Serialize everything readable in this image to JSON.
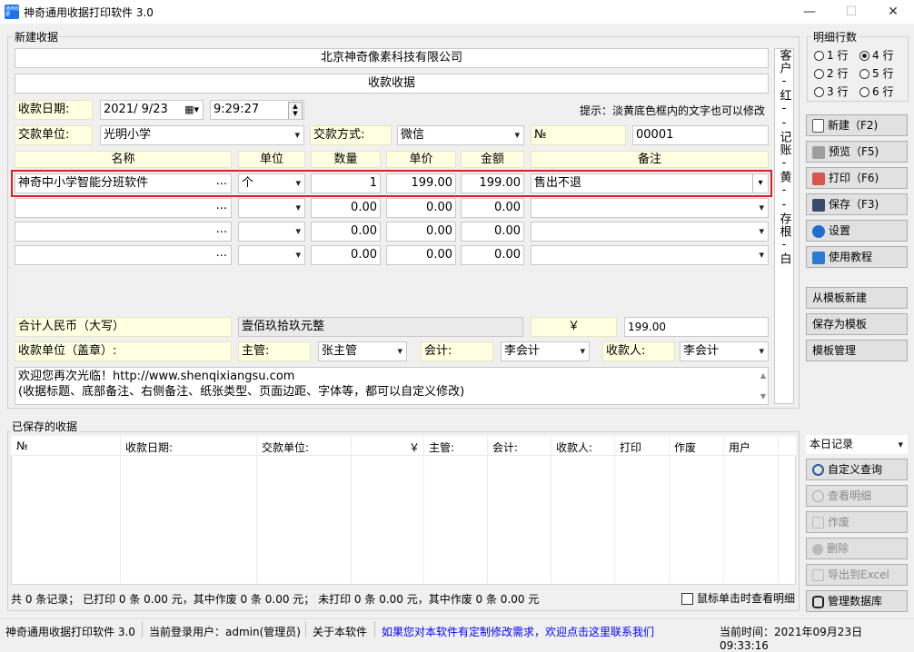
{
  "window": {
    "title": "神奇通用收据打印软件 3.0",
    "icon_text": "通用收据",
    "min": "—",
    "max": "☐",
    "close": "✕"
  },
  "receipt": {
    "group_label": "新建收据",
    "company": "北京神奇像素科技有限公司",
    "doc_title": "收款收据",
    "date_label": "收款日期:",
    "date_value": "2021/  9/23",
    "time_value": "9:29:27",
    "hint": "提示：淡黄底色框内的文字也可以修改",
    "payer_label": "交款单位:",
    "payer_value": "光明小学",
    "method_label": "交款方式:",
    "method_value": "微信",
    "no_label": "№",
    "no_value": "00001",
    "columns": [
      "名称",
      "单位",
      "数量",
      "单价",
      "金额",
      "备注"
    ],
    "rows": [
      {
        "name": "神奇中小学智能分班软件",
        "unit": "个",
        "qty": "1",
        "price": "199.00",
        "amount": "199.00",
        "note": "售出不退"
      },
      {
        "name": "",
        "unit": "",
        "qty": "",
        "price": "0.00",
        "amount": "0.00",
        "note": ""
      },
      {
        "name": "",
        "unit": "",
        "qty": "",
        "price": "0.00",
        "amount": "0.00",
        "note": ""
      },
      {
        "name": "",
        "unit": "",
        "qty": "",
        "price": "0.00",
        "amount": "0.00",
        "note": ""
      }
    ],
    "row_dots": "...",
    "total_label": "合计人民币（大写）",
    "total_words": "壹佰玖拾玖元整",
    "yen": "￥",
    "total_value": "199.00",
    "seal_label": "收款单位（盖章）:",
    "manager_label": "主管:",
    "manager_value": "张主管",
    "accountant_label": "会计:",
    "accountant_value": "李会计",
    "cashier_label": "收款人:",
    "cashier_value": "李会计",
    "footer_line1": "欢迎您再次光临！http://www.shenqixiangsu.com",
    "footer_line2": "(收据标题、底部备注、右侧备注、纸张类型、页面边距、字体等，都可以自定义修改)",
    "side_note": "客户-红--记账-黄--存根-白"
  },
  "rows_setting": {
    "label": "明细行数",
    "options": [
      "1 行",
      "2 行",
      "3 行",
      "4 行",
      "5 行",
      "6 行"
    ],
    "selected": "4 行"
  },
  "actions": {
    "new": "新建（F2)",
    "preview": "预览（F5)",
    "print": "打印（F6)",
    "save": "保存（F3)",
    "settings": "设置",
    "tutorial": "使用教程",
    "from_template": "从模板新建",
    "save_template": "保存为模板",
    "manage_template": "模板管理"
  },
  "saved": {
    "group_label": "已保存的收据",
    "columns": [
      "№",
      "收款日期:",
      "交款单位:",
      "￥",
      "主管:",
      "会计:",
      "收款人:",
      "打印",
      "作废",
      "用户"
    ],
    "filter_value": "本日记录",
    "query": "自定义查询",
    "view_detail": "查看明细",
    "void": "作废",
    "delete": "删除",
    "export": "导出到Excel",
    "manage_db": "管理数据库",
    "summary": "共 0 条记录；  已打印 0 条 0.00 元，其中作废 0 条 0.00 元；  未打印 0 条 0.00 元，其中作废 0 条 0.00 元",
    "click_detail": "鼠标单击时查看明细"
  },
  "status": {
    "app": "神奇通用收据打印软件 3.0",
    "user": "当前登录用户：admin(管理员)",
    "about": "关于本软件",
    "contact": "如果您对本软件有定制修改需求，欢迎点击这里联系我们",
    "time": "当前时间：2021年09月23日 09:33:16"
  },
  "colors": {
    "highlight_border": "#e02020",
    "link": "#0000ff",
    "field_yellow": "#ffffe1"
  }
}
